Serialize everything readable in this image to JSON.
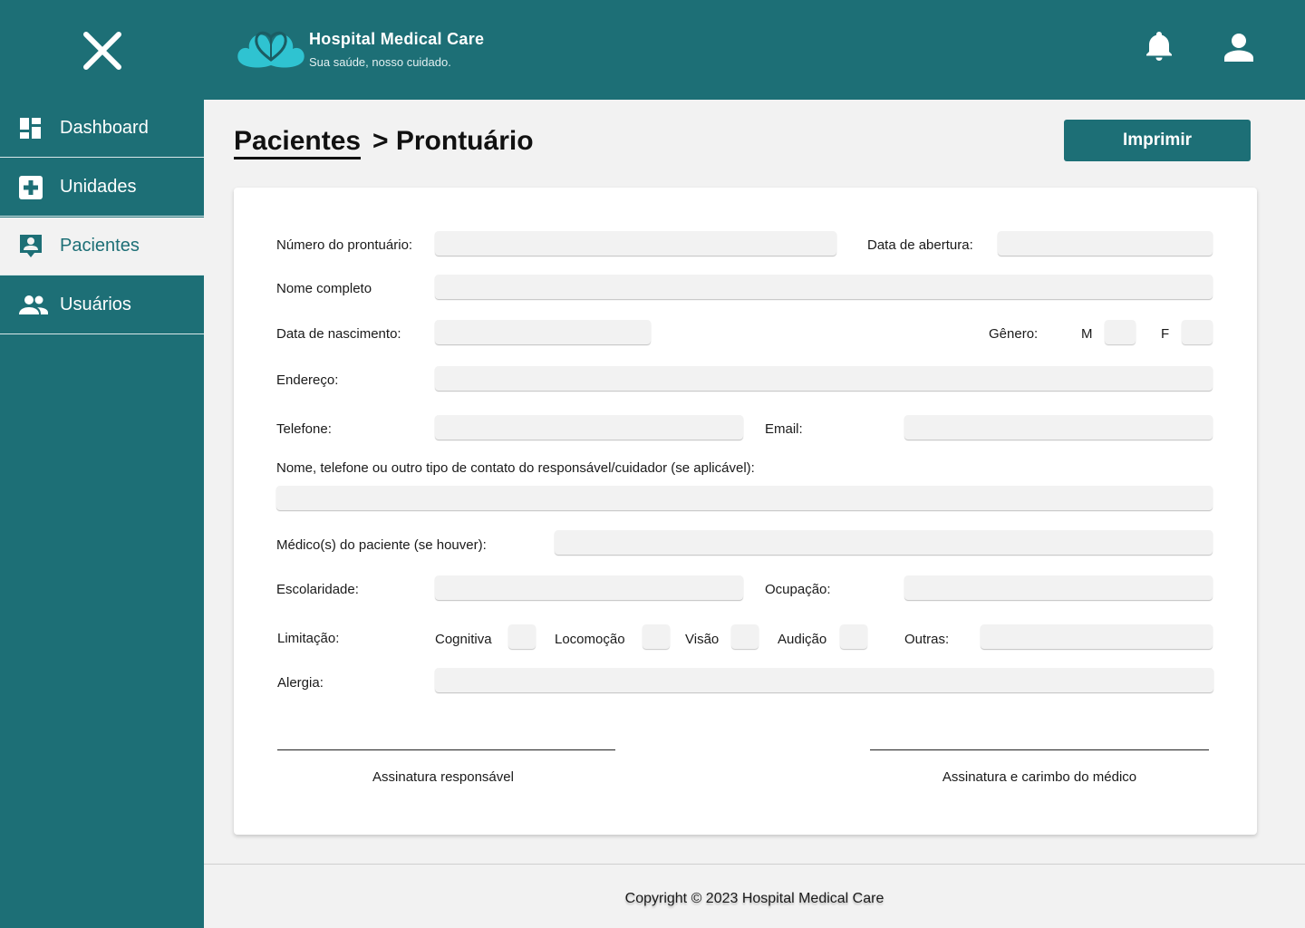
{
  "header": {
    "brand_name": "Hospital Medical Care",
    "brand_tagline": "Sua saúde, nosso cuidado.",
    "icons": [
      "close-icon",
      "logo-heart-icon",
      "bell-icon",
      "user-icon"
    ]
  },
  "sidebar": {
    "items": [
      {
        "label": "Dashboard",
        "icon": "dashboard-icon",
        "active": false
      },
      {
        "label": "Unidades",
        "icon": "medical-plus-icon",
        "active": false
      },
      {
        "label": "Pacientes",
        "icon": "patient-badge-icon",
        "active": true
      },
      {
        "label": "Usuários",
        "icon": "users-icon",
        "active": false
      }
    ]
  },
  "page": {
    "breadcrumb_link": "Pacientes",
    "breadcrumb_rest": "> Prontuário",
    "print_label": "Imprimir"
  },
  "form": {
    "record_number": "Número do prontuário:",
    "opening_date": "Data de abertura:",
    "full_name": "Nome completo",
    "birth_date": "Data de nascimento:",
    "gender": "Gênero:",
    "gender_m": "M",
    "gender_f": "F",
    "address": "Endereço:",
    "phone": "Telefone:",
    "email": "Email:",
    "guardian_contact": "Nome, telefone ou outro tipo de contato do responsável/cuidador (se aplicável):",
    "doctors": "Médico(s) do paciente (se houver):",
    "education": "Escolaridade:",
    "occupation": "Ocupação:",
    "limitation": "Limitação:",
    "lim_cognitive": "Cognitiva",
    "lim_mobility": "Locomoção",
    "lim_vision": "Visão",
    "lim_hearing": "Audição",
    "lim_other": "Outras:",
    "allergy": "Alergia:",
    "sig_guardian": "Assinatura responsável",
    "sig_doctor": "Assinatura e carimbo do médico"
  },
  "footer": {
    "copyright": "Copyright © 2023 Hospital Medical Care"
  },
  "colors": {
    "primary": "#1d6f76",
    "logo_light": "#2fc3d1",
    "logo_dark": "#1b5c63",
    "background": "#f2f2f2",
    "field": "#f2f2f2"
  }
}
